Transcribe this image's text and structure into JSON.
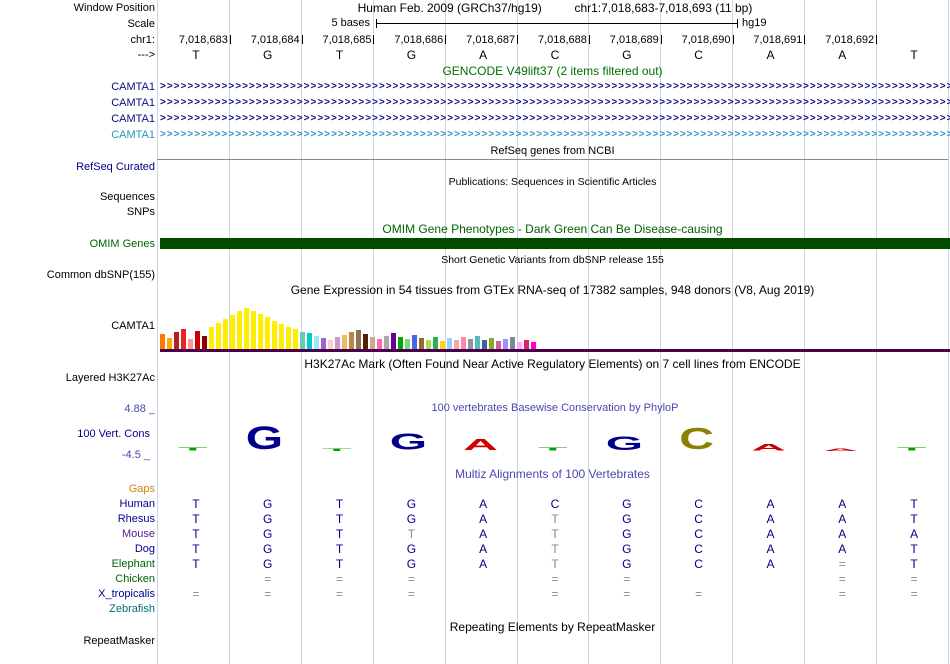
{
  "header": {
    "window_position_label": "Window Position",
    "assembly": "Human Feb. 2009 (GRCh37/hg19)",
    "position": "chr1:7,018,683-7,018,693 (11 bp)",
    "scale_label": "Scale",
    "scale_text": "5 bases",
    "genome_label": "hg19",
    "chrom_label": "chr1:",
    "direction_label": "--->",
    "coordinates": [
      "7,018,683",
      "7,018,684",
      "7,018,685",
      "7,018,686",
      "7,018,687",
      "7,018,688",
      "7,018,689",
      "7,018,690",
      "7,018,691",
      "7,018,692"
    ],
    "bases": [
      "T",
      "G",
      "T",
      "G",
      "A",
      "C",
      "G",
      "C",
      "A",
      "A",
      "T"
    ]
  },
  "colors": {
    "gridline": "#ccd4ec",
    "letter": "#00008b",
    "muted_letter": "#8a8a8a",
    "gap_symbol": "#8a8a8a"
  },
  "tracks": {
    "gencode": {
      "title": "GENCODE V49lift37 (2 items filtered out)",
      "title_color": "#007000",
      "arrow_char": ">",
      "items": [
        {
          "label": "CAMTA1",
          "color": "#0c0c82"
        },
        {
          "label": "CAMTA1",
          "color": "#0c0c82"
        },
        {
          "label": "CAMTA1",
          "color": "#0c0c82"
        },
        {
          "label": "CAMTA1",
          "color": "#2596be"
        }
      ]
    },
    "refseq": {
      "title": "RefSeq genes from NCBI",
      "label": "RefSeq Curated",
      "label_color": "#00008b"
    },
    "publications": {
      "title": "Publications: Sequences in Scientific Articles",
      "rows": [
        {
          "label": "Sequences"
        },
        {
          "label": "SNPs"
        }
      ]
    },
    "omim": {
      "title": "OMIM Gene Phenotypes - Dark Green Can Be Disease-causing",
      "title_color": "#006400",
      "label": "OMIM Genes",
      "label_color": "#006400",
      "bar_color": "#004d00"
    },
    "dbsnp": {
      "title": "Short Genetic Variants from dbSNP release 155",
      "label": "Common dbSNP(155)"
    },
    "gtex": {
      "title": "Gene Expression in 54 tissues from GTEx RNA-seq of 17382 samples, 948 donors (V8, Aug 2019)",
      "label": "CAMTA1",
      "baseline_color": "#4a004a",
      "bars": [
        {
          "c": "#ff7700",
          "h": 15
        },
        {
          "c": "#ffaa00",
          "h": 11
        },
        {
          "c": "#b22222",
          "h": 17
        },
        {
          "c": "#ee2222",
          "h": 20
        },
        {
          "c": "#ff9999",
          "h": 10
        },
        {
          "c": "#cc0000",
          "h": 18
        },
        {
          "c": "#8b0000",
          "h": 13
        },
        {
          "c": "#ffee00",
          "h": 22
        },
        {
          "c": "#ffee00",
          "h": 26
        },
        {
          "c": "#ffee00",
          "h": 30
        },
        {
          "c": "#ffee00",
          "h": 34
        },
        {
          "c": "#ffee00",
          "h": 38
        },
        {
          "c": "#ffee00",
          "h": 41
        },
        {
          "c": "#ffee00",
          "h": 38
        },
        {
          "c": "#ffee00",
          "h": 35
        },
        {
          "c": "#ffee00",
          "h": 32
        },
        {
          "c": "#ffee00",
          "h": 28
        },
        {
          "c": "#ffee00",
          "h": 25
        },
        {
          "c": "#ffee00",
          "h": 22
        },
        {
          "c": "#ffee00",
          "h": 20
        },
        {
          "c": "#66cdaa",
          "h": 17
        },
        {
          "c": "#00cccc",
          "h": 16
        },
        {
          "c": "#99e6ff",
          "h": 13
        },
        {
          "c": "#9966cc",
          "h": 11
        },
        {
          "c": "#ffcccc",
          "h": 9
        },
        {
          "c": "#cc99cc",
          "h": 12
        },
        {
          "c": "#eebb66",
          "h": 14
        },
        {
          "c": "#bb8844",
          "h": 17
        },
        {
          "c": "#8b7355",
          "h": 19
        },
        {
          "c": "#552200",
          "h": 15
        },
        {
          "c": "#ccaa88",
          "h": 12
        },
        {
          "c": "#ff69b4",
          "h": 10
        },
        {
          "c": "#aaaaaa",
          "h": 13
        },
        {
          "c": "#660099",
          "h": 16
        },
        {
          "c": "#00aa00",
          "h": 12
        },
        {
          "c": "#77dd77",
          "h": 10
        },
        {
          "c": "#4169e1",
          "h": 14
        },
        {
          "c": "#996633",
          "h": 11
        },
        {
          "c": "#aadd55",
          "h": 9
        },
        {
          "c": "#33aa55",
          "h": 12
        },
        {
          "c": "#ffd700",
          "h": 8
        },
        {
          "c": "#99ccff",
          "h": 11
        },
        {
          "c": "#eeaaaa",
          "h": 9
        },
        {
          "c": "#ff88aa",
          "h": 12
        },
        {
          "c": "#8899aa",
          "h": 10
        },
        {
          "c": "#55bbbb",
          "h": 13
        },
        {
          "c": "#336699",
          "h": 9
        },
        {
          "c": "#88aa22",
          "h": 11
        },
        {
          "c": "#cc6699",
          "h": 8
        },
        {
          "c": "#aa88ff",
          "h": 10
        },
        {
          "c": "#778899",
          "h": 12
        },
        {
          "c": "#ffaaff",
          "h": 7
        },
        {
          "c": "#dd2266",
          "h": 9
        },
        {
          "c": "#ff00cc",
          "h": 7
        }
      ]
    },
    "h3k27ac": {
      "title": "H3K27Ac Mark (Often Found Near Active Regulatory Elements) on 7 cell lines from ENCODE",
      "label": "Layered H3K27Ac"
    },
    "phylop": {
      "title": "100 vertebrates Basewise Conservation by PhyloP",
      "title_color": "#4848b0",
      "label": "100 Vert. Cons",
      "label_color": "#00008b",
      "max_label": "4.88 _",
      "min_label": "-4.5 _",
      "scale_color": "#4848b0",
      "logo": [
        {
          "ch": "T",
          "color": "#00a000",
          "scale": 0.13
        },
        {
          "ch": "G",
          "color": "#00008b",
          "scale": 1.0
        },
        {
          "ch": "T",
          "color": "#00a000",
          "scale": 0.1
        },
        {
          "ch": "G",
          "color": "#00008b",
          "scale": 0.72
        },
        {
          "ch": "A",
          "color": "#cc0000",
          "scale": 0.5
        },
        {
          "ch": "T",
          "color": "#00a000",
          "scale": 0.13
        },
        {
          "ch": "G",
          "color": "#00008b",
          "scale": 0.6
        },
        {
          "ch": "C",
          "color": "#8b8000",
          "scale": 0.95
        },
        {
          "ch": "A",
          "color": "#cc0000",
          "scale": 0.3
        },
        {
          "ch": "A",
          "color": "#cc0000",
          "scale": 0.12
        },
        {
          "ch": "T",
          "color": "#00a000",
          "scale": 0.13
        }
      ]
    },
    "multiz": {
      "title": "Multiz Alignments of 100 Vertebrates",
      "title_color": "#4848b0",
      "rows": [
        {
          "label": "Gaps",
          "label_color": "#cc8800",
          "cells": [
            "",
            "",
            "",
            "",
            "",
            "",
            "",
            "",
            "",
            "",
            ""
          ]
        },
        {
          "label": "Human",
          "label_color": "#00008b",
          "cells": [
            "T",
            "G",
            "T",
            "G",
            "A",
            "C",
            "G",
            "C",
            "A",
            "A",
            "T"
          ]
        },
        {
          "label": "Rhesus",
          "label_color": "#00008b",
          "cells": [
            "T",
            "G",
            "T",
            "G",
            "A",
            "t",
            "G",
            "C",
            "A",
            "A",
            "T"
          ]
        },
        {
          "label": "Mouse",
          "label_color": "#551a8b",
          "cells": [
            "T",
            "G",
            "T",
            "t",
            "A",
            "t",
            "G",
            "C",
            "A",
            "A",
            "A"
          ]
        },
        {
          "label": "Dog",
          "label_color": "#00008b",
          "cells": [
            "T",
            "G",
            "T",
            "G",
            "A",
            "t",
            "G",
            "C",
            "A",
            "A",
            "T"
          ]
        },
        {
          "label": "Elephant",
          "label_color": "#006400",
          "cells": [
            "T",
            "G",
            "T",
            "G",
            "A",
            "t",
            "G",
            "C",
            "A",
            "=",
            "T"
          ]
        },
        {
          "label": "Chicken",
          "label_color": "#006400",
          "cells": [
            "",
            "=",
            "=",
            "=",
            "",
            "=",
            "=",
            "",
            "",
            "=",
            "="
          ]
        },
        {
          "label": "X_tropicalis",
          "label_color": "#00008b",
          "cells": [
            "=",
            "=",
            "=",
            "=",
            "",
            "=",
            "=",
            "=",
            "",
            "=",
            "="
          ]
        },
        {
          "label": "Zebrafish",
          "label_color": "#007070",
          "cells": [
            "",
            "",
            "",
            "",
            "",
            "",
            "",
            "",
            "",
            "",
            ""
          ]
        }
      ]
    },
    "repeatmasker": {
      "title": "Repeating Elements by RepeatMasker",
      "label": "RepeatMasker"
    }
  }
}
